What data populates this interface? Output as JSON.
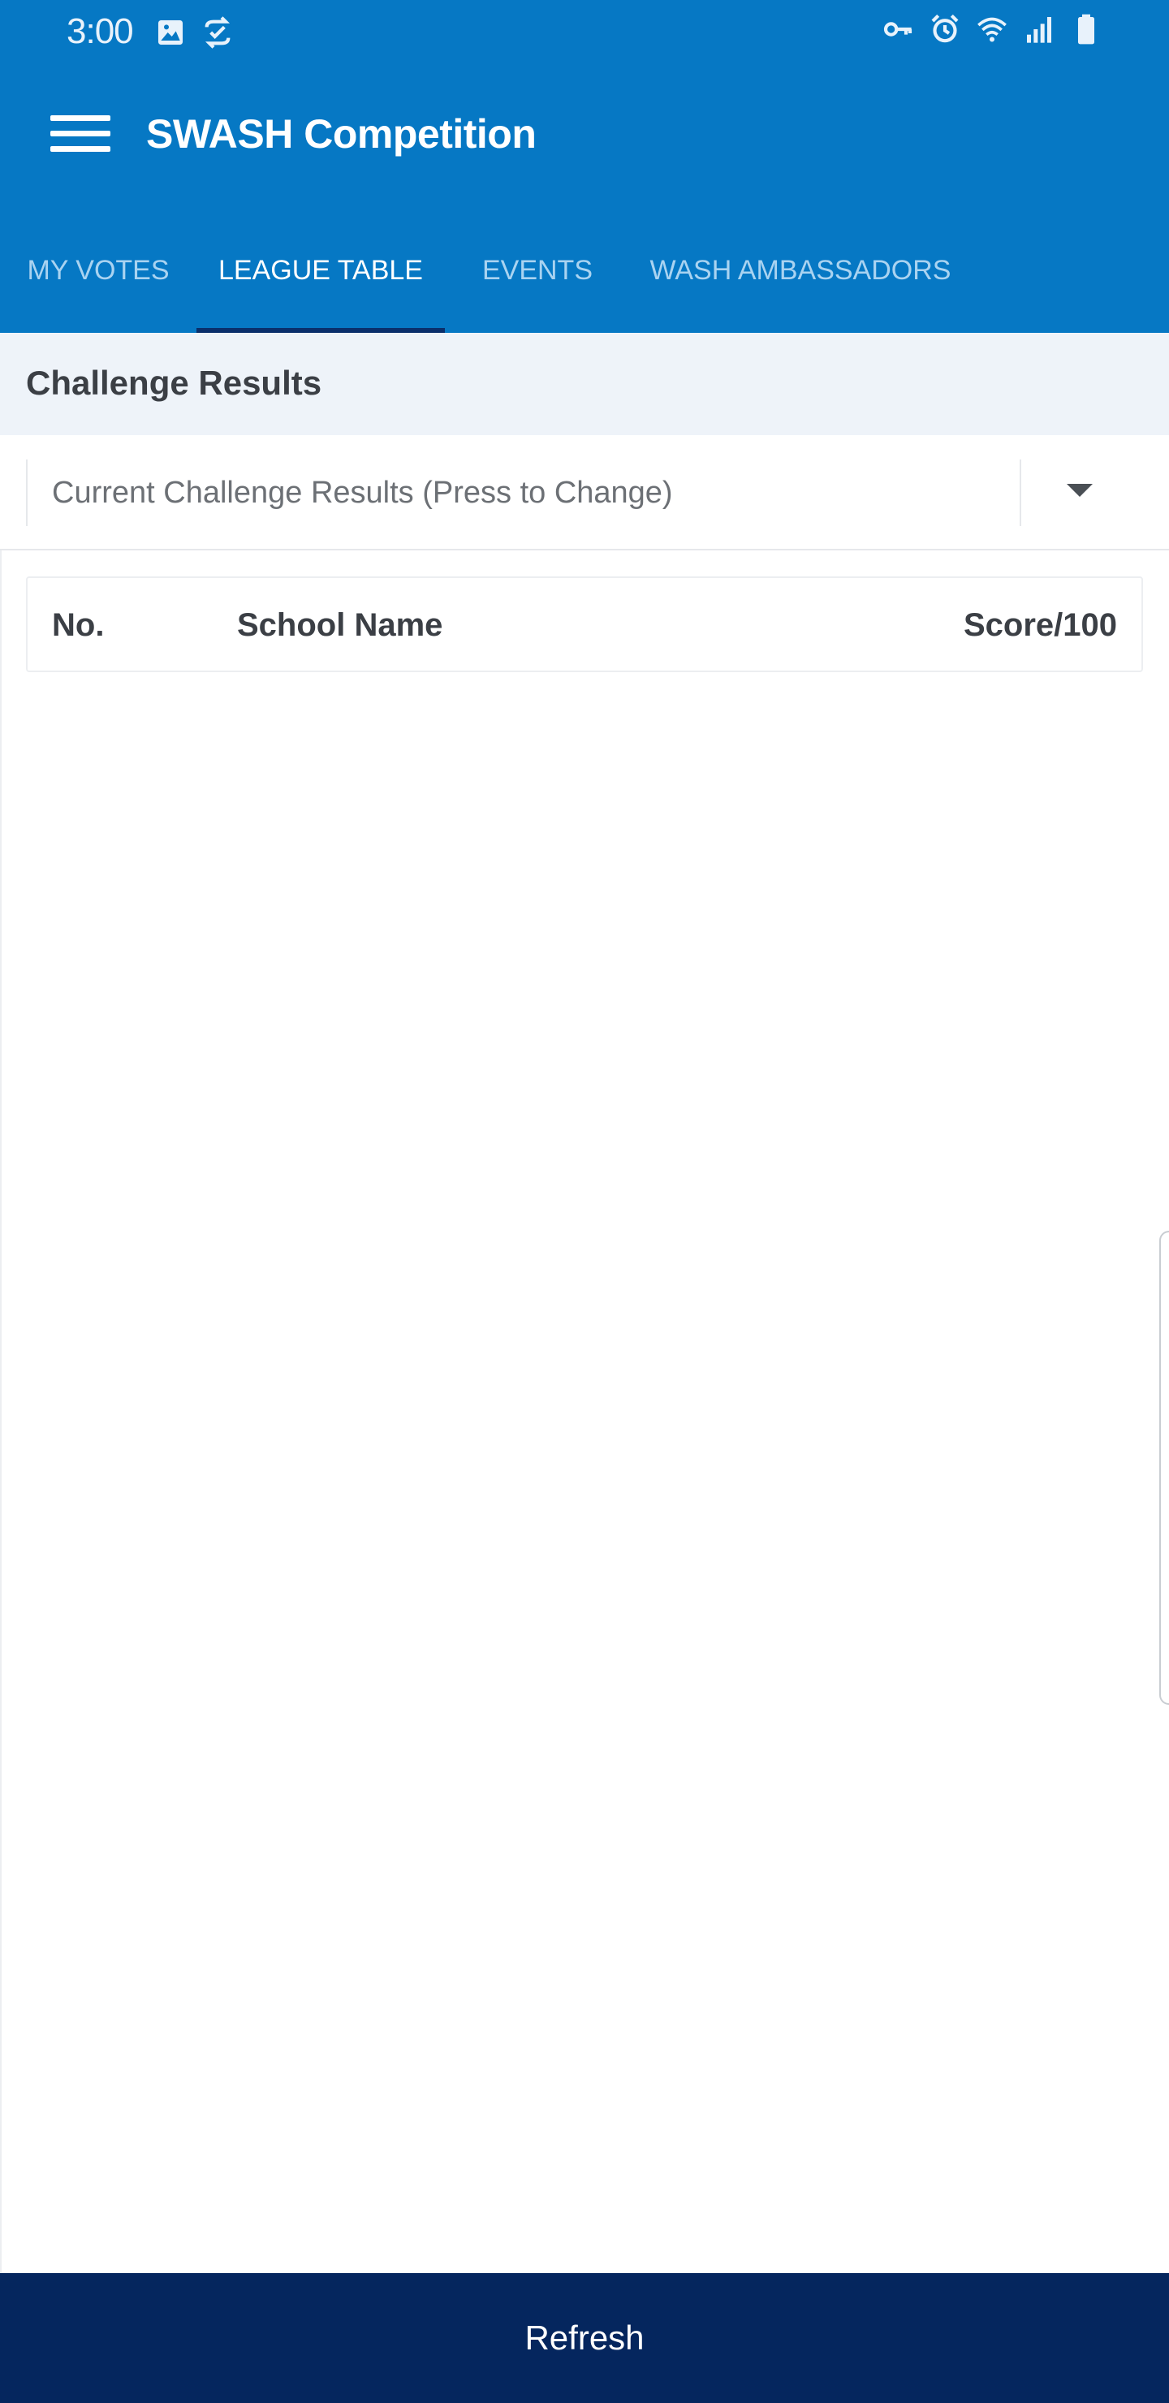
{
  "status_bar": {
    "time": "3:00",
    "left_icons": [
      "image-icon",
      "sync-check-icon"
    ],
    "right_icons": [
      "vpn-key-icon",
      "alarm-icon",
      "wifi-icon",
      "signal-icon",
      "battery-icon"
    ]
  },
  "app_bar": {
    "title": "SWASH Competition",
    "menu_icon": "hamburger-menu-icon"
  },
  "tabs": [
    {
      "label": "MY VOTES",
      "active": false
    },
    {
      "label": "LEAGUE TABLE",
      "active": true
    },
    {
      "label": "EVENTS",
      "active": false
    },
    {
      "label": "WASH AMBASSADORS",
      "active": false
    }
  ],
  "section": {
    "title": "Challenge Results"
  },
  "picker": {
    "value": "Current Challenge Results (Press to Change)",
    "icon": "dropdown-arrow-icon"
  },
  "table": {
    "columns": [
      "No.",
      "School Name",
      "Score/100"
    ],
    "rows": []
  },
  "footer": {
    "refresh_label": "Refresh"
  },
  "colors": {
    "primary": "#0678c4",
    "tab_indicator": "#0a2f6b",
    "footer_button": "#05265e",
    "section_bg": "#eef3f9",
    "text_dark": "#3b3f45"
  }
}
